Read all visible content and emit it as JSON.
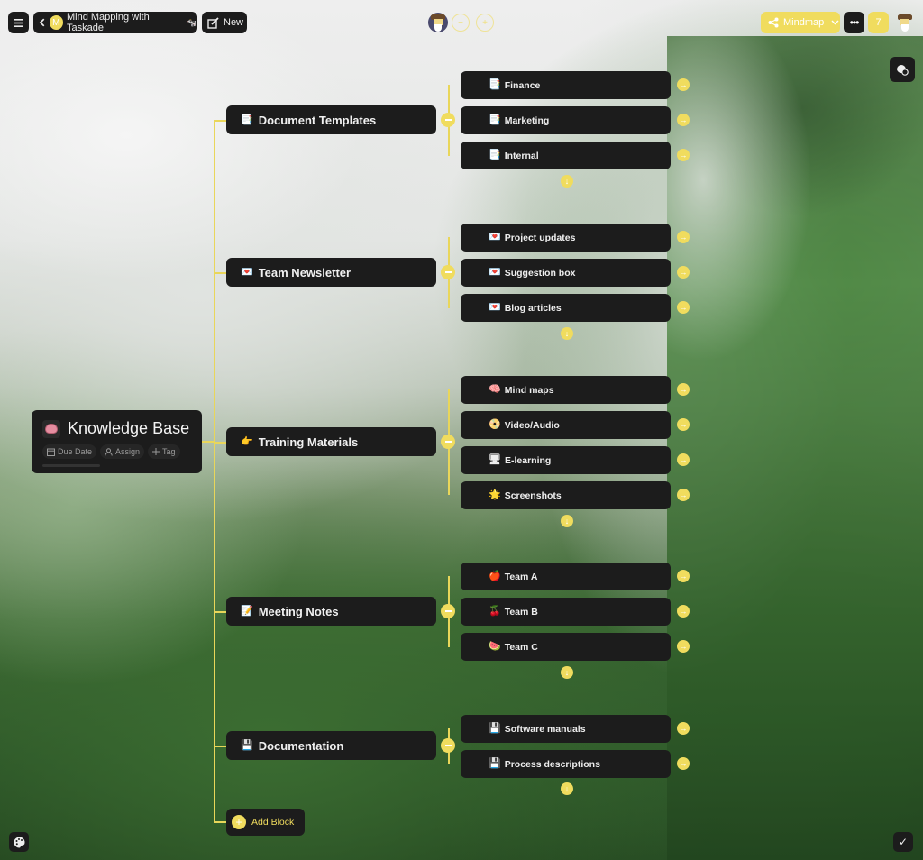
{
  "topbar": {
    "menu_icon": "hamburger-icon",
    "back_icon": "chevron-left-icon",
    "workspace_initial": "M",
    "title": "Mind Mapping with Taskade",
    "title_emoji": "🐄",
    "new_label": "New",
    "view_label": "Mindmap",
    "view_icon": "share-nodes-icon",
    "more_label": "•••",
    "member_count": "7"
  },
  "colors": {
    "accent": "#f0dc5e",
    "node_bg": "#1c1c1c",
    "node_text": "#f0f0f0"
  },
  "root": {
    "emoji": "🧠",
    "title": "Knowledge Base",
    "chips": [
      {
        "icon": "calendar-icon",
        "label": "Due Date"
      },
      {
        "icon": "user-icon",
        "label": "Assign"
      },
      {
        "icon": "plus-icon",
        "label": "Tag"
      }
    ]
  },
  "branches": [
    {
      "emoji": "📑",
      "label": "Document Templates",
      "children": [
        {
          "emoji": "📑",
          "label": "Finance"
        },
        {
          "emoji": "📑",
          "label": "Marketing"
        },
        {
          "emoji": "📑",
          "label": "Internal"
        }
      ]
    },
    {
      "emoji": "💌",
      "label": "Team Newsletter",
      "children": [
        {
          "emoji": "💌",
          "label": "Project updates"
        },
        {
          "emoji": "💌",
          "label": "Suggestion box"
        },
        {
          "emoji": "💌",
          "label": "Blog articles"
        }
      ]
    },
    {
      "emoji": "👉",
      "label": "Training Materials",
      "children": [
        {
          "emoji": "🧠",
          "label": "Mind maps"
        },
        {
          "emoji": "📀",
          "label": "Video/Audio"
        },
        {
          "emoji": "🖥",
          "label": "E-learning"
        },
        {
          "emoji": "🌟",
          "label": "Screenshots"
        }
      ]
    },
    {
      "emoji": "📝",
      "label": "Meeting Notes",
      "children": [
        {
          "emoji": "🍎",
          "label": "Team A"
        },
        {
          "emoji": "🍒",
          "label": "Team B"
        },
        {
          "emoji": "🍉",
          "label": "Team C"
        }
      ]
    },
    {
      "emoji": "💾",
      "label": "Documentation",
      "children": [
        {
          "emoji": "💾",
          "label": "Software manuals"
        },
        {
          "emoji": "💾",
          "label": "Process descriptions"
        }
      ]
    }
  ],
  "add_block_label": "Add Block",
  "icons": {
    "arrow_right": "→",
    "arrow_down": "↓",
    "plus": "+",
    "check": "✓"
  }
}
